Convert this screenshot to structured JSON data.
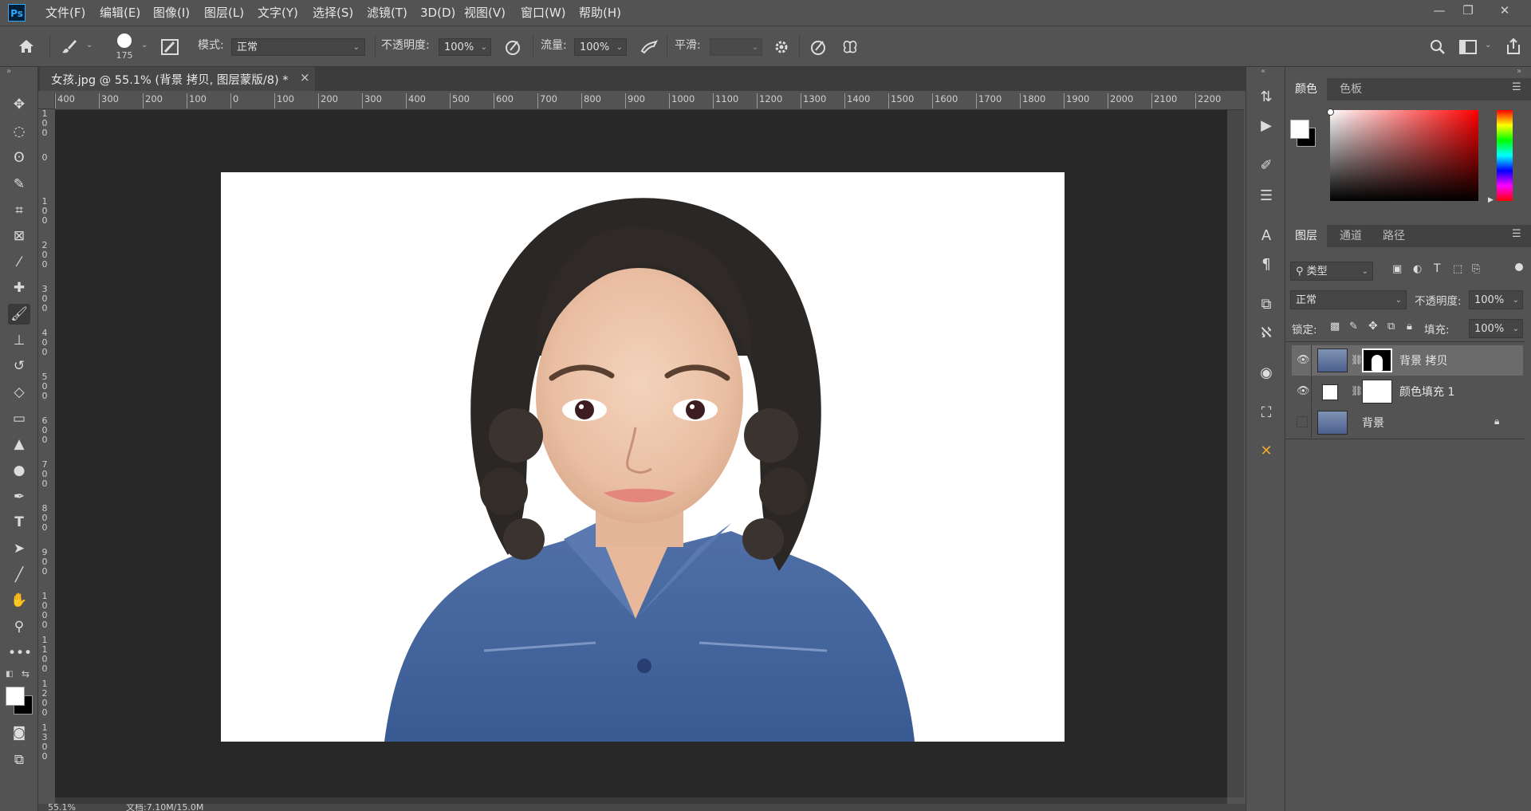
{
  "app": {
    "logo": "Ps"
  },
  "menu": [
    {
      "label": "文件(F)"
    },
    {
      "label": "编辑(E)"
    },
    {
      "label": "图像(I)"
    },
    {
      "label": "图层(L)"
    },
    {
      "label": "文字(Y)"
    },
    {
      "label": "选择(S)"
    },
    {
      "label": "滤镜(T)"
    },
    {
      "label": "3D(D)"
    },
    {
      "label": "视图(V)"
    },
    {
      "label": "窗口(W)"
    },
    {
      "label": "帮助(H)"
    }
  ],
  "window_controls": {
    "minimize": "—",
    "restore": "❐",
    "close": "✕"
  },
  "options": {
    "brush_size": "175",
    "mode_label": "模式:",
    "mode_value": "正常",
    "opacity_label": "不透明度:",
    "opacity_value": "100%",
    "flow_label": "流量:",
    "flow_value": "100%",
    "smooth_label": "平滑:",
    "smooth_value": ""
  },
  "document": {
    "tab_title": "女孩.jpg @ 55.1% (背景 拷贝, 图层蒙版/8) *",
    "tab_close": "×",
    "zoom": "55.1%",
    "doc_info": "文档:7.10M/15.0M"
  },
  "ruler": {
    "h_ticks": [
      "400",
      "300",
      "200",
      "100",
      "0",
      "100",
      "200",
      "300",
      "400",
      "500",
      "600",
      "700",
      "800",
      "900",
      "1000",
      "1100",
      "1200",
      "1300",
      "1400",
      "1500",
      "1600",
      "1700",
      "1800",
      "1900",
      "2000",
      "2100",
      "2200"
    ],
    "v_ticks": [
      "1\n0\n0",
      "0",
      "1\n0\n0",
      "2\n0\n0",
      "3\n0\n0",
      "4\n0\n0",
      "5\n0\n0",
      "6\n0\n0",
      "7\n0\n0",
      "8\n0\n0",
      "9\n0\n0",
      "1\n0\n0\n0",
      "1\n1\n0\n0",
      "1\n2\n0\n0",
      "1\n3\n0\n0"
    ]
  },
  "panels": {
    "color_tabs": [
      "颜色",
      "色板"
    ],
    "layers_tabs": [
      "图层",
      "通道",
      "路径"
    ],
    "filter_kind": "类型",
    "blend_mode": "正常",
    "opacity_label": "不透明度:",
    "opacity_value": "100%",
    "lock_label": "锁定:",
    "fill_label": "填充:",
    "fill_value": "100%",
    "layers": [
      {
        "name": "背景 拷贝",
        "visible": true,
        "selected": true
      },
      {
        "name": "颜色填充 1",
        "visible": true,
        "selected": false
      },
      {
        "name": "背景",
        "visible": false,
        "selected": false,
        "locked": true
      }
    ]
  },
  "colors": {
    "accent": "#31a8ff",
    "canvas_bg": "#282828",
    "panel_bg": "#535353"
  }
}
